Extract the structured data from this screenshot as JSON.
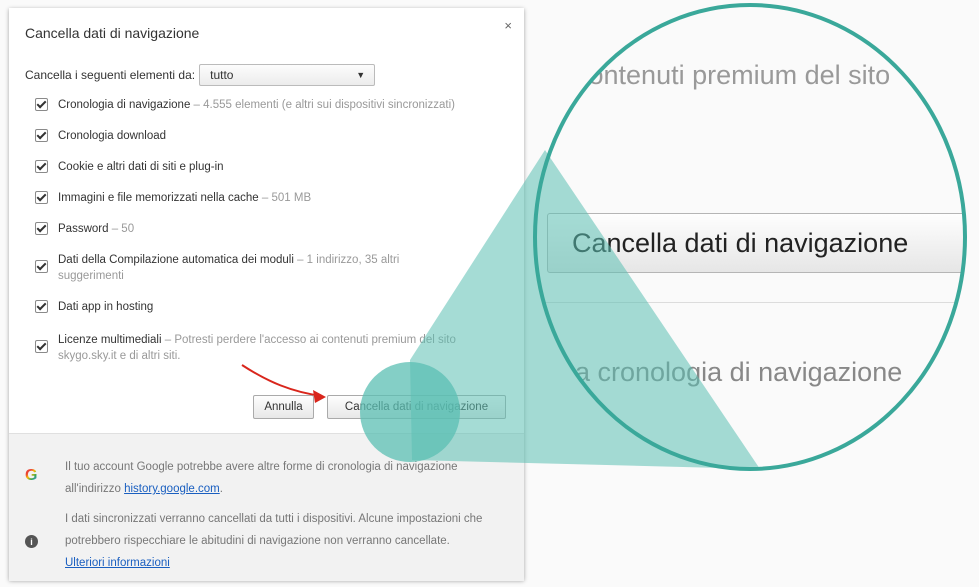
{
  "dialog": {
    "title": "Cancella dati di navigazione",
    "close_glyph": "×",
    "period_label": "Cancella i seguenti elementi da:",
    "period_value": "tutto",
    "items": [
      {
        "label": "Cronologia di navigazione",
        "sep": " – ",
        "detail": "4.555 elementi (e altri sui dispositivi sincronizzati)"
      },
      {
        "label": "Cronologia download",
        "sep": "",
        "detail": ""
      },
      {
        "label": "Cookie e altri dati di siti e plug-in",
        "sep": "",
        "detail": ""
      },
      {
        "label": "Immagini e file memorizzati nella cache",
        "sep": " – ",
        "detail": "501 MB"
      },
      {
        "label": "Password",
        "sep": " – ",
        "detail": "50"
      },
      {
        "label": "Dati della Compilazione automatica dei moduli",
        "sep": " – ",
        "detail": "1 indirizzo, 35 altri suggerimenti"
      },
      {
        "label": "Dati app in hosting",
        "sep": "",
        "detail": ""
      },
      {
        "label": "Licenze multimediali",
        "sep": " – ",
        "detail": "Potresti perdere l'accesso ai contenuti premium del sito skygo.sky.it e di altri siti."
      }
    ],
    "cancel_label": "Annulla",
    "clear_label": "Cancella dati di navigazione"
  },
  "footer": {
    "google_text": "Il tuo account Google potrebbe avere altre forme di cronologia di navigazione all'indirizzo ",
    "google_link": "history.google.com",
    "google_after": ".",
    "sync_text": "I dati sincronizzati verranno cancellati da tutti i dispositivi. Alcune impostazioni che potrebbero rispecchiare le abitudini di navigazione non verranno cancellate.",
    "sync_link": "Ulteriori informazioni",
    "google_icon": "google-g-icon",
    "info_icon": "info-icon"
  },
  "zoom": {
    "top_text": "contenuti premium del sito",
    "button_text": "Cancella dati di navigazione",
    "bottom_text": "a cronologia di navigazione"
  },
  "colors": {
    "teal": "#5bbfb3",
    "teal_border": "#3aa89a",
    "arrow": "#d9261c",
    "link": "#1a5fc0"
  }
}
